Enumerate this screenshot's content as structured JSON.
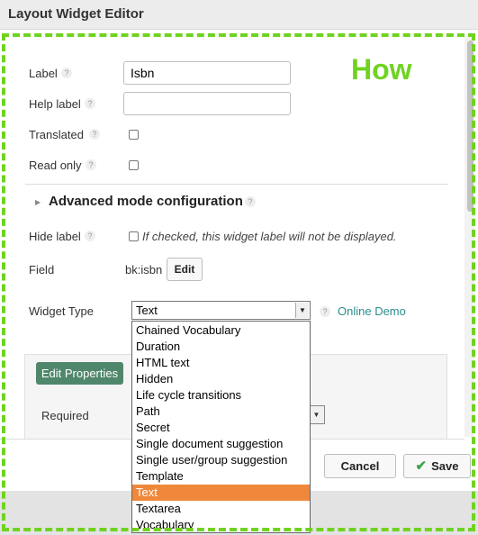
{
  "dialog": {
    "title": "Layout Widget Editor"
  },
  "overlay": {
    "how_text": "How"
  },
  "form": {
    "label": {
      "label": "Label",
      "value": "Isbn"
    },
    "help_label": {
      "label": "Help label",
      "value": ""
    },
    "translated": {
      "label": "Translated",
      "checked": false
    },
    "read_only": {
      "label": "Read only",
      "checked": false
    },
    "advanced": {
      "label": "Advanced mode configuration"
    },
    "hide_label": {
      "label": "Hide label",
      "checked": false,
      "hint": "If checked, this widget label will not be displayed."
    },
    "field": {
      "label": "Field",
      "value": "bk:isbn",
      "edit_label": "Edit"
    },
    "widget_type": {
      "label": "Widget Type",
      "selected": "Text",
      "online_demo": "Online Demo",
      "options": [
        "Chained Vocabulary",
        "Duration",
        "HTML text",
        "Hidden",
        "Life cycle transitions",
        "Path",
        "Secret",
        "Single document suggestion",
        "Single user/group suggestion",
        "Template",
        "Text",
        "Textarea",
        "Vocabulary"
      ]
    }
  },
  "properties": {
    "edit_label": "Edit Properties",
    "required_label": "Required"
  },
  "footer": {
    "cancel_label": "Cancel",
    "save_label": "Save"
  },
  "help_glyph": "?",
  "colors": {
    "accent_green": "#6fd321",
    "selected_option": "#f0883b",
    "primary_button": "#50876a",
    "link": "#2a8d8d"
  }
}
